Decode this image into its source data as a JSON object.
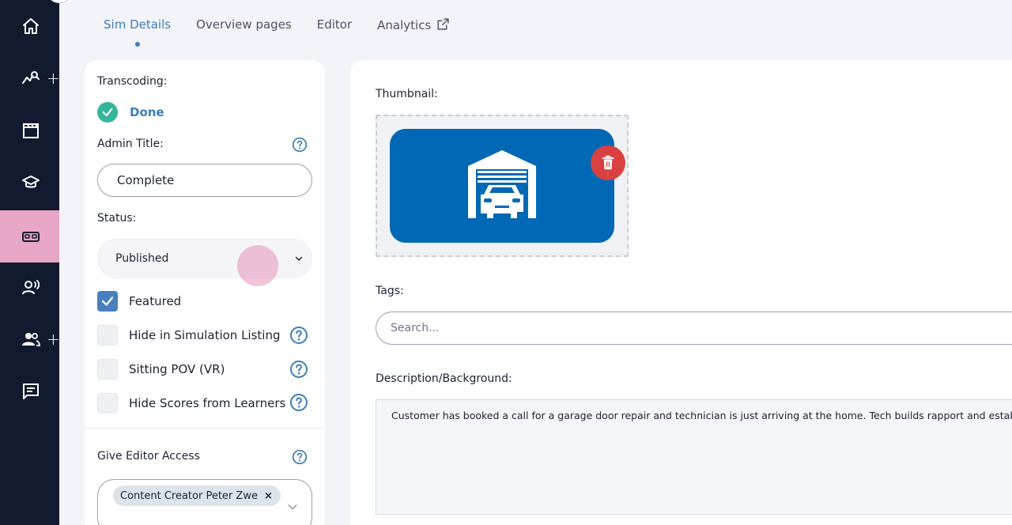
{
  "sidebar": {
    "items": [
      {
        "icon": "home-icon",
        "plus": false,
        "active": false
      },
      {
        "icon": "analytics-search-icon",
        "plus": true,
        "active": false
      },
      {
        "icon": "clapperboard-icon",
        "plus": false,
        "active": false
      },
      {
        "icon": "graduation-cap-icon",
        "plus": false,
        "active": false
      },
      {
        "icon": "vr-headset-icon",
        "plus": false,
        "active": true
      },
      {
        "icon": "speaking-person-icon",
        "plus": false,
        "active": false
      },
      {
        "icon": "users-icon",
        "plus": true,
        "active": false
      },
      {
        "icon": "message-icon",
        "plus": false,
        "active": false
      }
    ],
    "plus_symbol": "+",
    "active_color": "#e7a6c6",
    "background": "#111a2e"
  },
  "tabs": [
    {
      "label": "Sim Details",
      "active": true
    },
    {
      "label": "Overview pages",
      "active": false
    },
    {
      "label": "Editor",
      "active": false
    },
    {
      "label": "Analytics",
      "active": false,
      "external": true
    }
  ],
  "left": {
    "transcoding_label": "Transcoding:",
    "transcoding_status": "Done",
    "admin_title_label": "Admin Title:",
    "admin_title_value": "Complete",
    "status_label": "Status:",
    "status_value": "Published",
    "checkboxes": [
      {
        "label": "Featured",
        "checked": true,
        "help": false
      },
      {
        "label": "Hide in Simulation Listing",
        "checked": false,
        "help": true
      },
      {
        "label": "Sitting POV (VR)",
        "checked": false,
        "help": true
      },
      {
        "label": "Hide Scores from Learners",
        "checked": false,
        "help": true
      }
    ],
    "editor_access_label": "Give Editor Access",
    "editor_chip": "Content Creator Peter Zwe",
    "chip_remove": "×"
  },
  "right": {
    "thumbnail_label": "Thumbnail:",
    "tags_label": "Tags:",
    "tags_placeholder": "Search...",
    "description_label": "Description/Background:",
    "description_text": "Customer has booked a call for a garage door repair and technician is just arriving at the home. Tech builds rapport and establishes custo"
  },
  "colors": {
    "accent": "#3d7db8",
    "success": "#36b59a",
    "danger": "#d94141",
    "thumbnail_bg": "#0068b5"
  }
}
